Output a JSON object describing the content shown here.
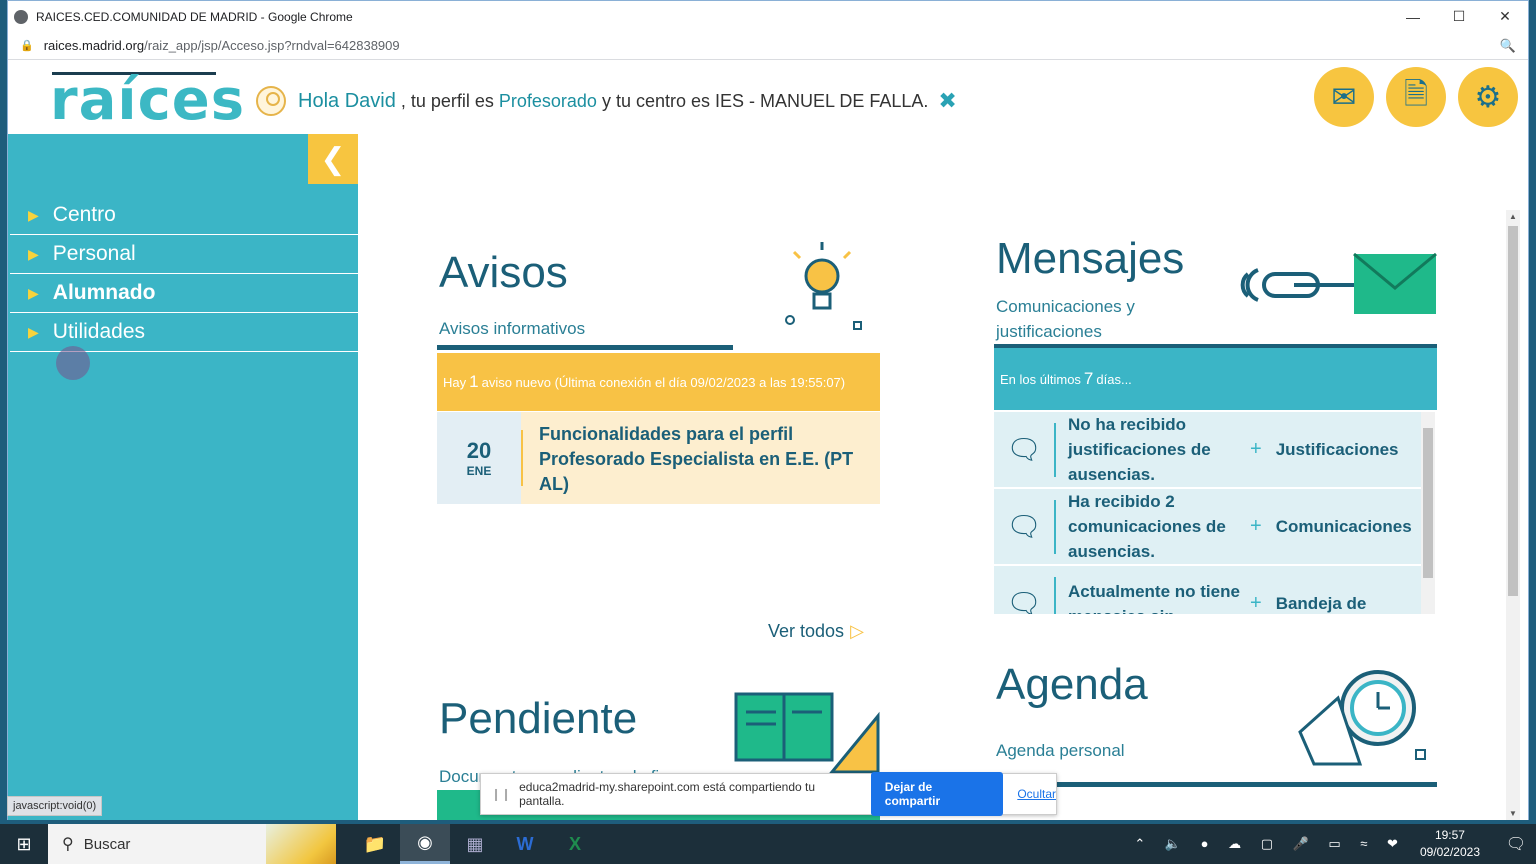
{
  "browser": {
    "window_title": "RAICES.CED.COMUNIDAD DE MADRID - Google Chrome",
    "url_domain": "raices.madrid.org",
    "url_path": "/raiz_app/jsp/Acceso.jsp?rndval=642838909",
    "status_text": "javascript:void(0)"
  },
  "header": {
    "logo": "raíces",
    "greeting_hola": "Hola David",
    "greeting_mid": ", tu perfil es",
    "profile": "Profesorado",
    "greeting_end": "y tu centro es IES - MANUEL DE FALLA.",
    "icons": [
      "envelope-icon",
      "documents-icon",
      "settings-icon"
    ]
  },
  "sidebar": {
    "items": [
      {
        "label": "Centro"
      },
      {
        "label": "Personal"
      },
      {
        "label": "Alumnado"
      },
      {
        "label": "Utilidades"
      }
    ]
  },
  "avisos": {
    "title": "Avisos",
    "subtitle": "Avisos informativos",
    "banner_pre": "Hay",
    "banner_count": "1",
    "banner_post": "aviso nuevo (Última conexión el día 09/02/2023 a las 19:55:07)",
    "item": {
      "day": "20",
      "month": "ENE",
      "text": "Funcionalidades para el perfil Profesorado Especialista en E.E. (PT AL)"
    },
    "ver_todos": "Ver todos"
  },
  "mensajes": {
    "title": "Mensajes",
    "subtitle": "Comunicaciones y justificaciones",
    "banner_pre": "En los últimos",
    "banner_count": "7",
    "banner_post": "días...",
    "rows": [
      {
        "text": "No ha recibido justificaciones de ausencias.",
        "link": "Justificaciones"
      },
      {
        "text": "Ha recibido 2 comunicaciones de ausencias.",
        "link": "Comunicaciones"
      },
      {
        "text": "Actualmente no tiene mensajes sin",
        "link": "Bandeja de"
      }
    ]
  },
  "pendiente": {
    "title": "Pendiente",
    "subtitle": "Documentos pendientes de firma"
  },
  "agenda": {
    "title": "Agenda",
    "subtitle": "Agenda personal"
  },
  "share_popup": {
    "text": "educa2madrid-my.sharepoint.com está compartiendo tu pantalla.",
    "stop_button": "Dejar de compartir",
    "hide_link": "Ocultar"
  },
  "taskbar": {
    "search_placeholder": "Buscar",
    "time": "19:57",
    "date": "09/02/2023"
  },
  "colors": {
    "teal": "#3bb5c6",
    "yellow": "#f7c540",
    "dark_blue": "#1b5f78"
  }
}
